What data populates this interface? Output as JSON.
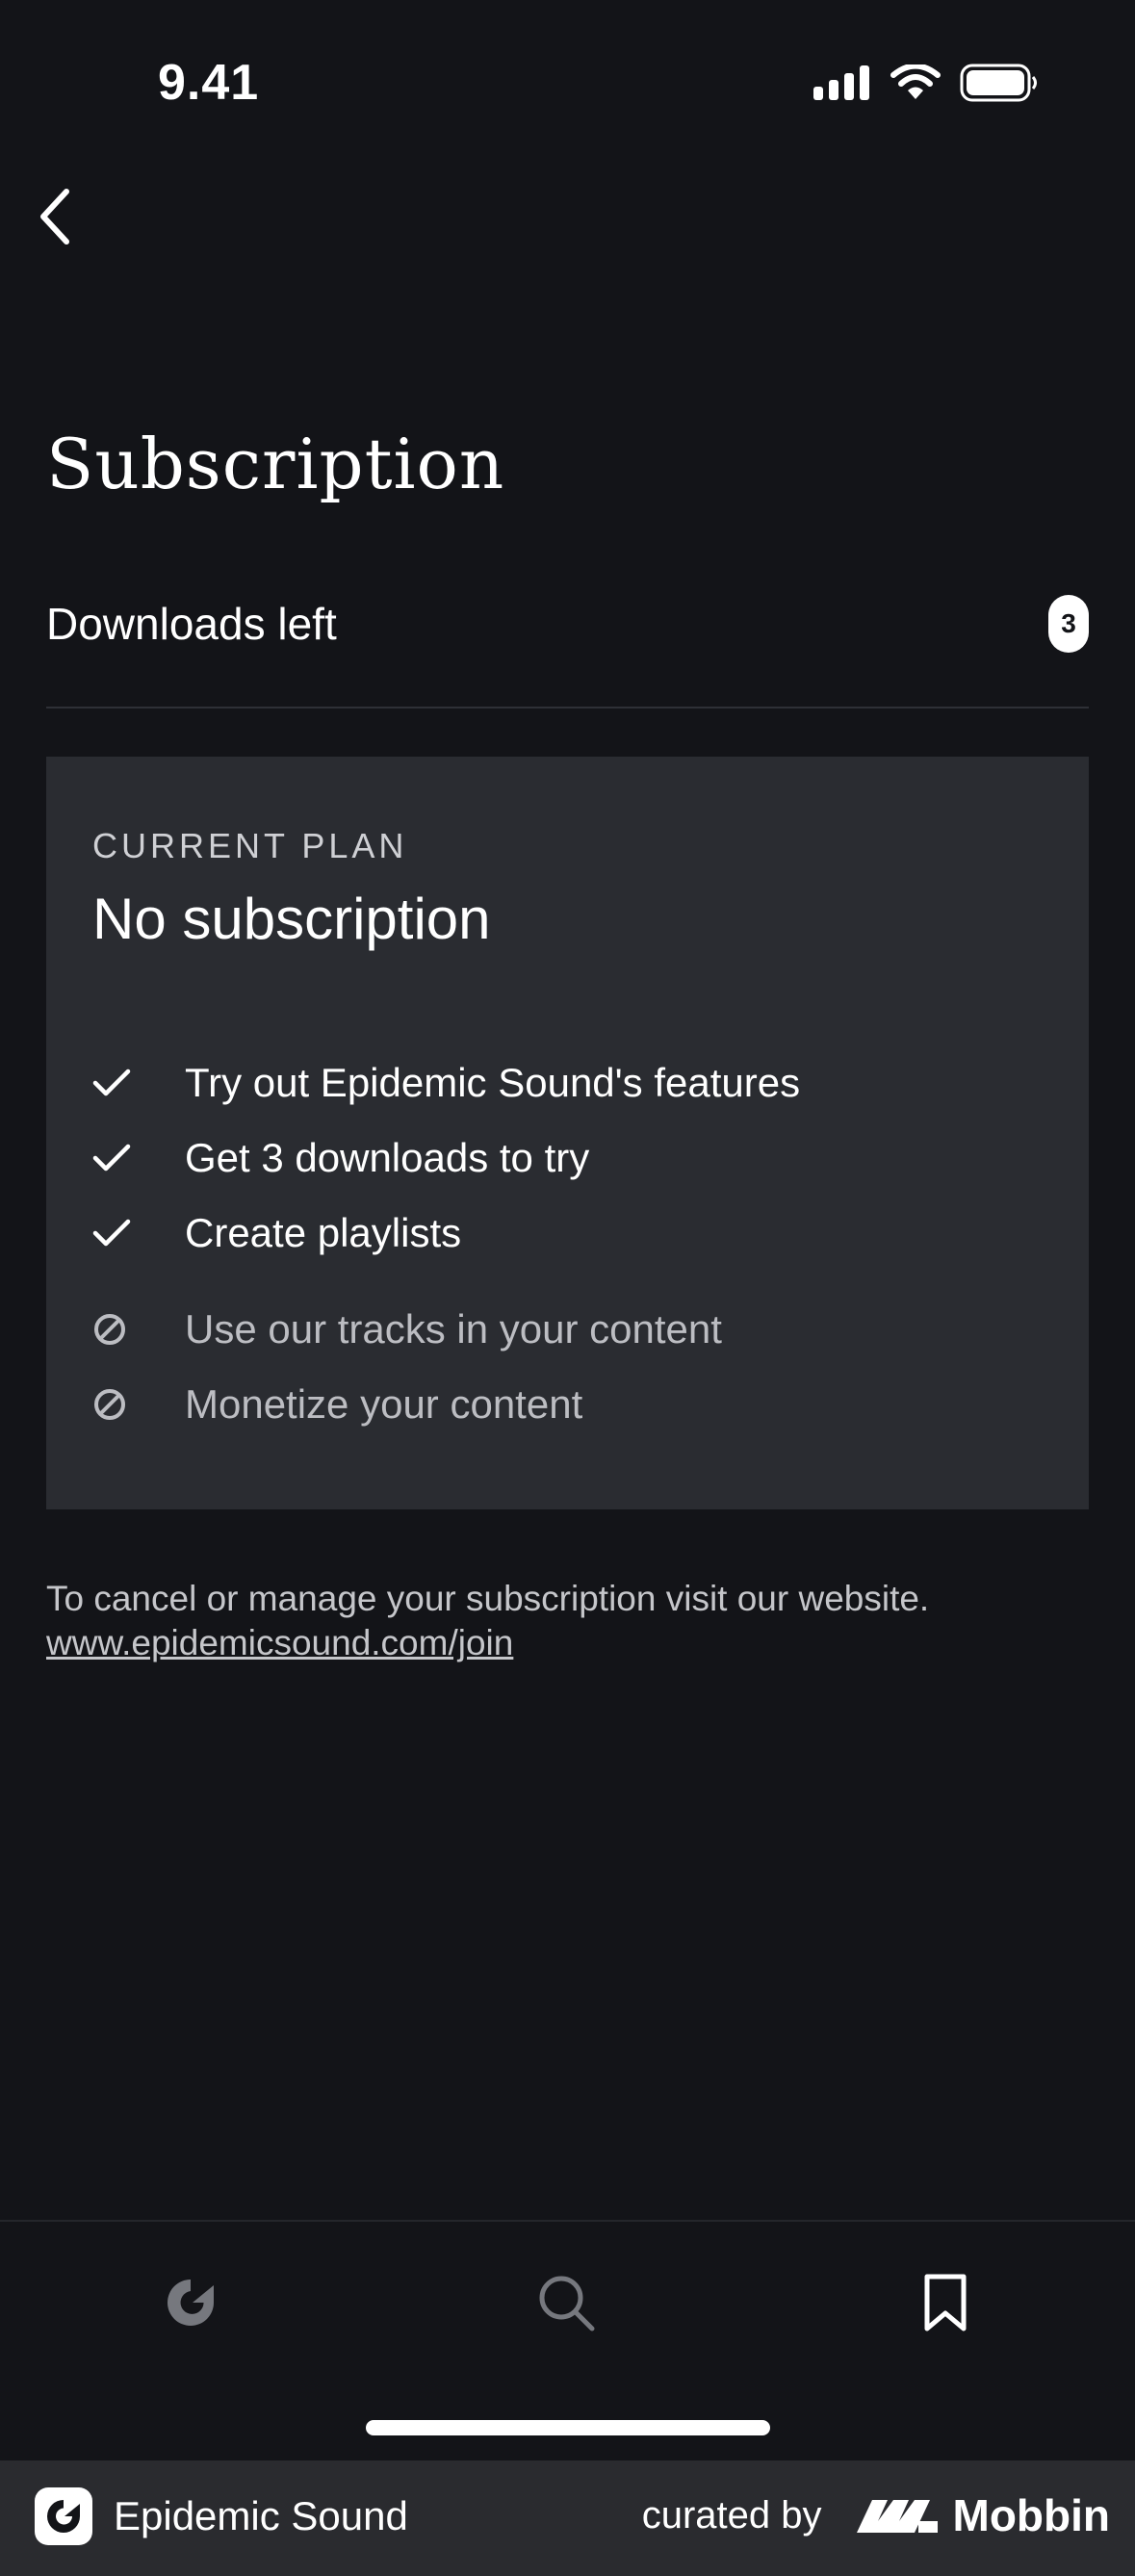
{
  "status_bar": {
    "time": "9.41"
  },
  "header": {
    "title": "Subscription"
  },
  "downloads": {
    "label": "Downloads left",
    "count": "3"
  },
  "plan": {
    "eyebrow": "CURRENT PLAN",
    "name": "No subscription",
    "included": [
      "Try out Epidemic Sound's features",
      "Get 3 downloads to try",
      "Create playlists"
    ],
    "excluded": [
      "Use our tracks in your content",
      "Monetize your content"
    ]
  },
  "footer": {
    "note": "To cancel or manage your subscription visit our website.",
    "link": "www.epidemicsound.com/join"
  },
  "tabs": [
    {
      "icon": "epidemic-home-icon"
    },
    {
      "icon": "search-icon"
    },
    {
      "icon": "bookmark-icon"
    }
  ],
  "attribution": {
    "app_name": "Epidemic Sound",
    "curated_label": "curated by",
    "curator": "Mobbin"
  }
}
